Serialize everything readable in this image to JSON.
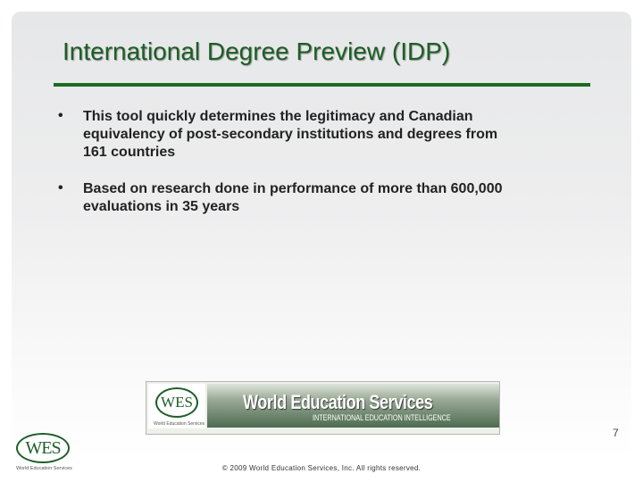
{
  "slide": {
    "title": "International Degree Preview (IDP)",
    "bullets": [
      {
        "marker": "•",
        "text": "This tool quickly determines the legitimacy and Canadian equivalency of post-secondary institutions and degrees from 161 countries"
      },
      {
        "marker": "•",
        "text": "Based on research done in performance of more than 600,000 evaluations in 35 years"
      }
    ],
    "banner": {
      "logo_text": "WES",
      "logo_subtext": "World Education Services",
      "name": "World Education Services",
      "tagline": "INTERNATIONAL EDUCATION INTELLIGENCE"
    },
    "footer_logo": {
      "text": "WES",
      "subtext": "World Education Services"
    },
    "copyright": "© 2009 World Education Services, Inc. All rights reserved.",
    "page_number": "7"
  },
  "colors": {
    "accent": "#1e6b22",
    "title": "#1c5e26"
  }
}
